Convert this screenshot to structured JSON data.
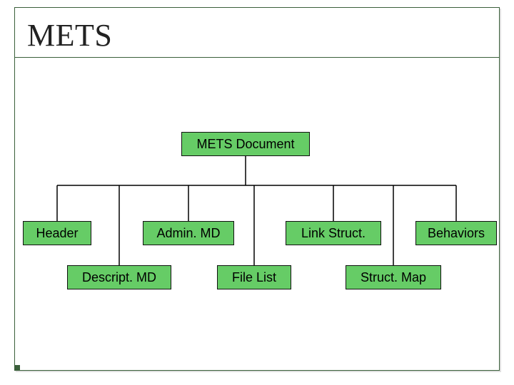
{
  "title": "METS",
  "diagram": {
    "root": "METS Document",
    "children": [
      {
        "label": "Header"
      },
      {
        "label": "Descript. MD"
      },
      {
        "label": "Admin. MD"
      },
      {
        "label": "File List"
      },
      {
        "label": "Link Struct."
      },
      {
        "label": "Struct. Map"
      },
      {
        "label": "Behaviors"
      }
    ]
  }
}
